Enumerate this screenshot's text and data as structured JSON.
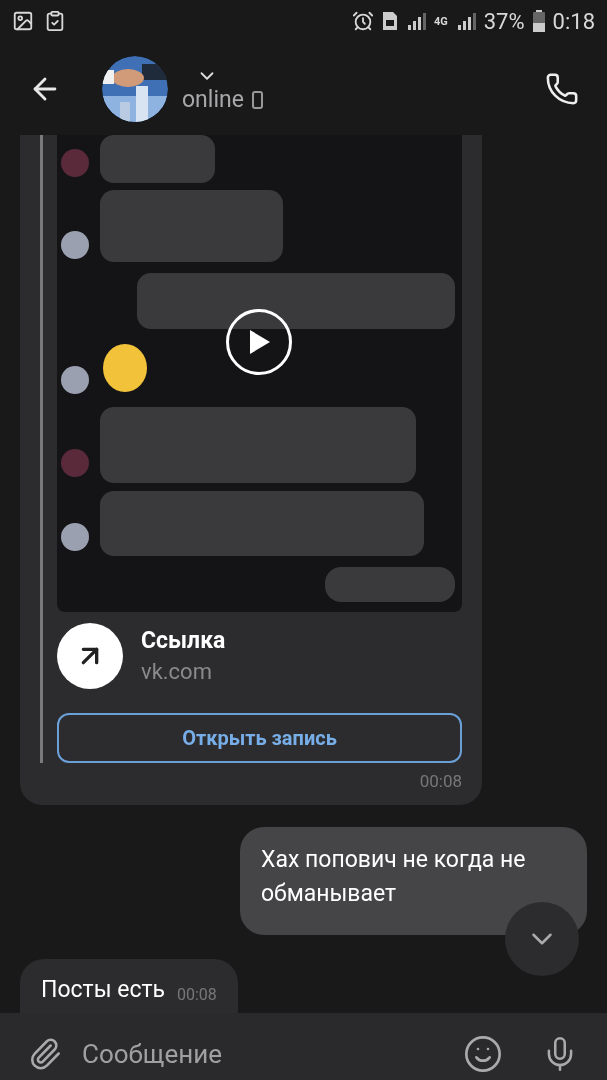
{
  "status_bar": {
    "battery": "37%",
    "time": "0:18",
    "network": "4G"
  },
  "header": {
    "status": "online"
  },
  "messages": [
    {
      "kind": "attachment",
      "link": {
        "title": "Ссылка",
        "domain": "vk.com"
      },
      "button": "Открыть запись",
      "time": "00:08"
    },
    {
      "kind": "outgoing",
      "text": "Хах попович не когда не обманывает"
    },
    {
      "kind": "incoming",
      "text": "Посты есть",
      "time": "00:08"
    }
  ],
  "composer": {
    "placeholder": "Сообщение"
  }
}
